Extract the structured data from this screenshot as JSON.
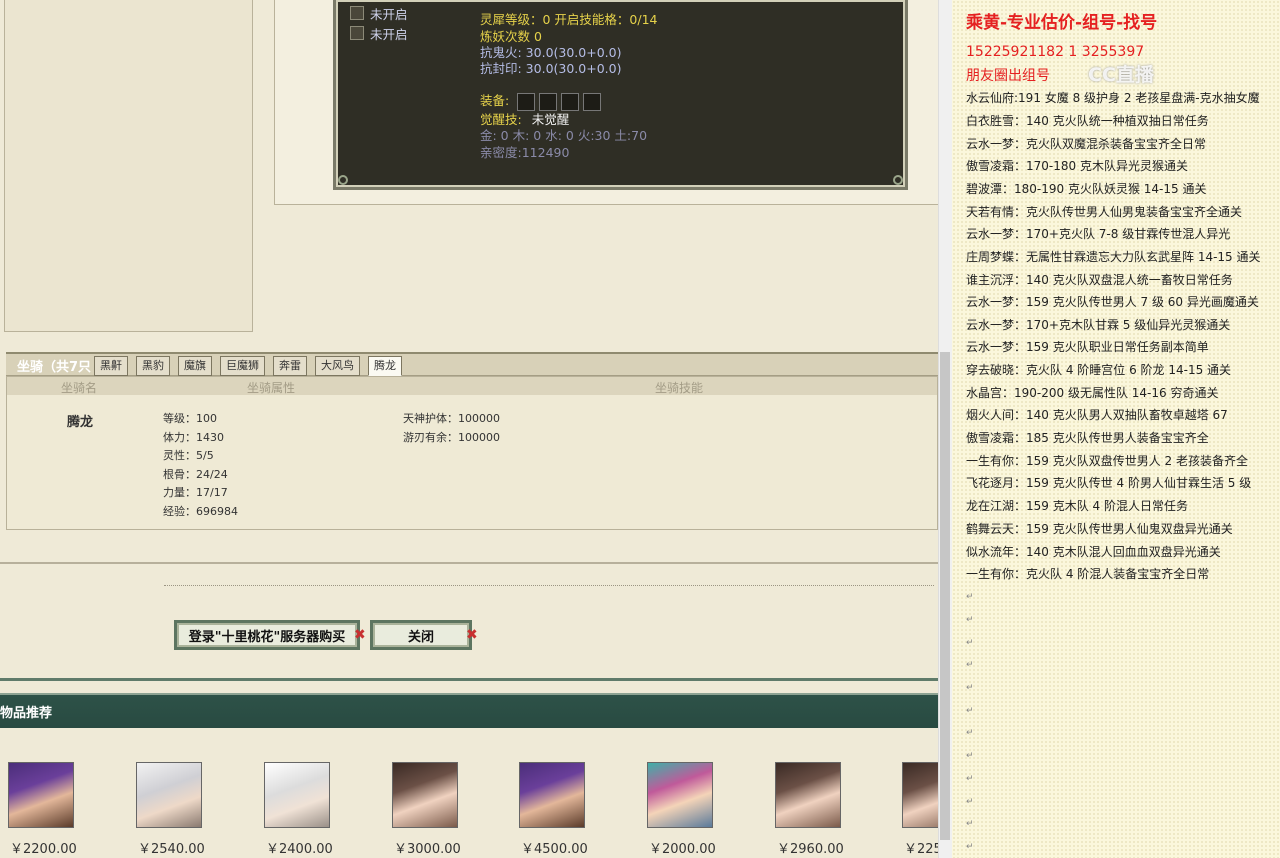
{
  "upper_panel": {
    "slots": [
      "未开启",
      "未开启"
    ],
    "spirit_level": "灵犀等级：0 开启技能格：0/14",
    "refine_count": "炼妖次数 0",
    "resist_ghost_fire": "抗鬼火: 30.0(30.0+0.0)",
    "resist_seal": "抗封印: 30.0(30.0+0.0)",
    "equip_label": "装备:",
    "awaken_label": "觉醒技:",
    "awaken_value": "未觉醒",
    "elements": "金: 0 木: 0 水: 0 火:30 土:70",
    "intimacy": "亲密度:112490"
  },
  "mounts": {
    "title": "坐骑（共7只",
    "tabs": [
      "黑鼾",
      "黑豹",
      "魔旗",
      "巨魔狮",
      "奔雷",
      "大风鸟",
      "腾龙"
    ],
    "active_tab": "腾龙",
    "headers": [
      "坐骑名",
      "坐骑属性",
      "坐骑技能"
    ],
    "selected": {
      "name": "腾龙",
      "attributes": [
        "等级：100",
        "体力：1430",
        "灵性：5/5",
        "根骨：24/24",
        "力量：17/17",
        "经验：696984"
      ],
      "skills": [
        {
          "label": "天神护体：",
          "value": "100000"
        },
        {
          "label": "游刃有余：",
          "value": "100000"
        }
      ]
    }
  },
  "actions": {
    "login_buy": "登录\"十里桃花\"服务器购买",
    "close": "关闭"
  },
  "recommend": {
    "title": "物品推荐",
    "prices": [
      "￥2200.00",
      "￥2540.00",
      "￥2400.00",
      "￥3000.00",
      "￥4500.00",
      "￥2000.00",
      "￥2960.00",
      "￥225"
    ]
  },
  "notes": {
    "header": "乘黄-专业估价-组号-找号",
    "phones": "15225921182   1 3255397",
    "subheader": "朋友圈出组号",
    "watermark": "CC直播",
    "lines": [
      "水云仙府:191 女魔 8 级护身 2 老孩星盘满-克水抽女魔",
      "白衣胜雪：140 克火队统一种植双抽日常任务",
      "云水一梦：克火队双魔混杀装备宝宝齐全日常",
      "傲雪凌霜：170-180 克木队异光灵猴通关",
      "碧波潭：180-190 克火队妖灵猴 14-15 通关",
      "天若有情：克火队传世男人仙男鬼装备宝宝齐全通关",
      "云水一梦：170+克火队 7-8 级甘霖传世混人异光",
      "庄周梦蝶：无属性甘霖遗忘大力队玄武星阵 14-15 通关",
      "谁主沉浮：140 克火队双盘混人统一畜牧日常任务",
      "云水一梦：159 克火队传世男人 7 级 60 异光画魔通关",
      "云水一梦：170+克木队甘霖 5 级仙异光灵猴通关",
      "云水一梦：159 克火队职业日常任务副本简单",
      "穿去破晓：克火队 4 阶睡宫位 6 阶龙 14-15 通关",
      "水晶宫：190-200 级无属性队 14-16 穷奇通关",
      "烟火人间：140 克火队男人双抽队畜牧卓越塔 67",
      "傲雪凌霜：185 克火队传世男人装备宝宝齐全",
      "一生有你：159 克火队双盘传世男人 2 老孩装备齐全",
      "飞花逐月：159 克火队传世 4 阶男人仙甘霖生活 5 级",
      "龙在江湖：159 克木队 4 阶混人日常任务",
      "鹤舞云天：159 克火队传世男人仙鬼双盘异光通关",
      "似水流年：140 克木队混人回血血双盘异光通关",
      "一生有你：克火队 4 阶混人装备宝宝齐全日常"
    ]
  }
}
